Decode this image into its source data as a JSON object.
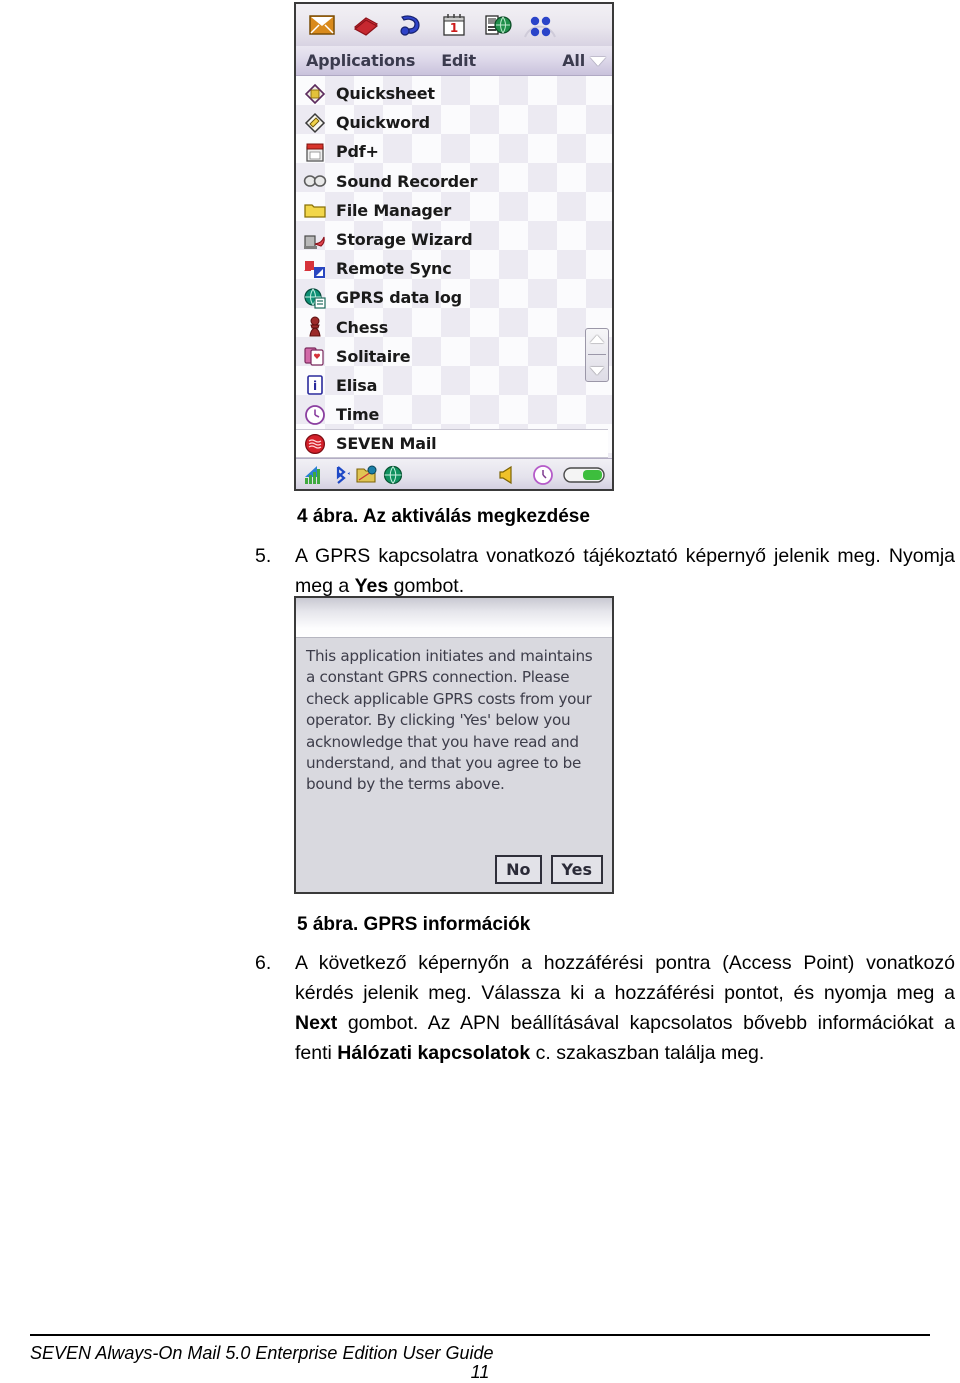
{
  "figure1": {
    "name": "applications-list-screenshot",
    "toolbar_icons": [
      {
        "name": "envelope-icon",
        "label": "Messaging"
      },
      {
        "name": "book-icon",
        "label": "Contacts"
      },
      {
        "name": "phone-handset-icon",
        "label": "Telephone"
      },
      {
        "name": "calendar-icon",
        "label": "Calendar",
        "day": "1"
      },
      {
        "name": "connectivity-icon",
        "label": "Connectivity"
      },
      {
        "name": "grid-dots-icon",
        "label": "Applications"
      }
    ],
    "menubar": {
      "applications_label": "Applications",
      "edit_label": "Edit",
      "filter_label": "All",
      "filter_chevron": "chevron-down-icon"
    },
    "apps": [
      {
        "icon": "quicksheet-icon",
        "label": "Quicksheet",
        "selected": false
      },
      {
        "icon": "quickword-icon",
        "label": "Quickword",
        "selected": false
      },
      {
        "icon": "pdf-icon",
        "label": "Pdf+",
        "selected": false
      },
      {
        "icon": "sound-recorder-icon",
        "label": "Sound Recorder",
        "selected": false
      },
      {
        "icon": "folder-icon",
        "label": "File Manager",
        "selected": false
      },
      {
        "icon": "storage-wizard-icon",
        "label": "Storage Wizard",
        "selected": false
      },
      {
        "icon": "remote-sync-icon",
        "label": "Remote Sync",
        "selected": false
      },
      {
        "icon": "gprs-data-log-icon",
        "label": "GPRS data log",
        "selected": false
      },
      {
        "icon": "chess-icon",
        "label": "Chess",
        "selected": false
      },
      {
        "icon": "solitaire-icon",
        "label": "Solitaire",
        "selected": false
      },
      {
        "icon": "elisa-icon",
        "label": "Elisa",
        "selected": false
      },
      {
        "icon": "clock-icon",
        "label": "Time",
        "selected": false
      },
      {
        "icon": "seven-mail-icon",
        "label": "SEVEN Mail",
        "selected": true
      }
    ],
    "statusbar_icons": [
      {
        "name": "signal-strength-icon"
      },
      {
        "name": "bluetooth-icon"
      },
      {
        "name": "network-folder-icon"
      },
      {
        "name": "globe-icon"
      },
      {
        "name": "speaker-icon"
      },
      {
        "name": "clock-status-icon"
      },
      {
        "name": "battery-icon"
      }
    ]
  },
  "caption1": "4 ábra. Az aktiválás megkezdése",
  "step5": {
    "number": "5.",
    "text_part1": "A GPRS kapcsolatra vonatkozó tájékoztató képernyő jelenik meg. Nyomja meg a ",
    "bold1": "Yes",
    "text_part2": " gombot."
  },
  "figure2": {
    "name": "gprs-information-dialog-screenshot",
    "message": "This application initiates and maintains a constant GPRS connection. Please check applicable GPRS costs from your operator. By clicking 'Yes' below you acknowledge that you have read and understand, and that you agree to be bound by the terms above.",
    "buttons": {
      "no_label": "No",
      "yes_label": "Yes"
    }
  },
  "caption2": "5 ábra. GPRS információk",
  "step6": {
    "number": "6.",
    "text_part1": "A következő képernyőn a hozzáférési pontra (Access Point) vonatkozó kérdés jelenik meg. Válassza ki a hozzáférési pontot, és nyomja meg a ",
    "bold1": "Next",
    "text_part2": " gombot. Az APN beállításával kapcsolatos bővebb információkat a fenti ",
    "bold2": "Hálózati kapcsolatok",
    "text_part3": " c. szakaszban találja meg."
  },
  "footer": {
    "guide_title": "SEVEN Always-On Mail 5.0 Enterprise Edition User Guide",
    "page_number": "11"
  }
}
